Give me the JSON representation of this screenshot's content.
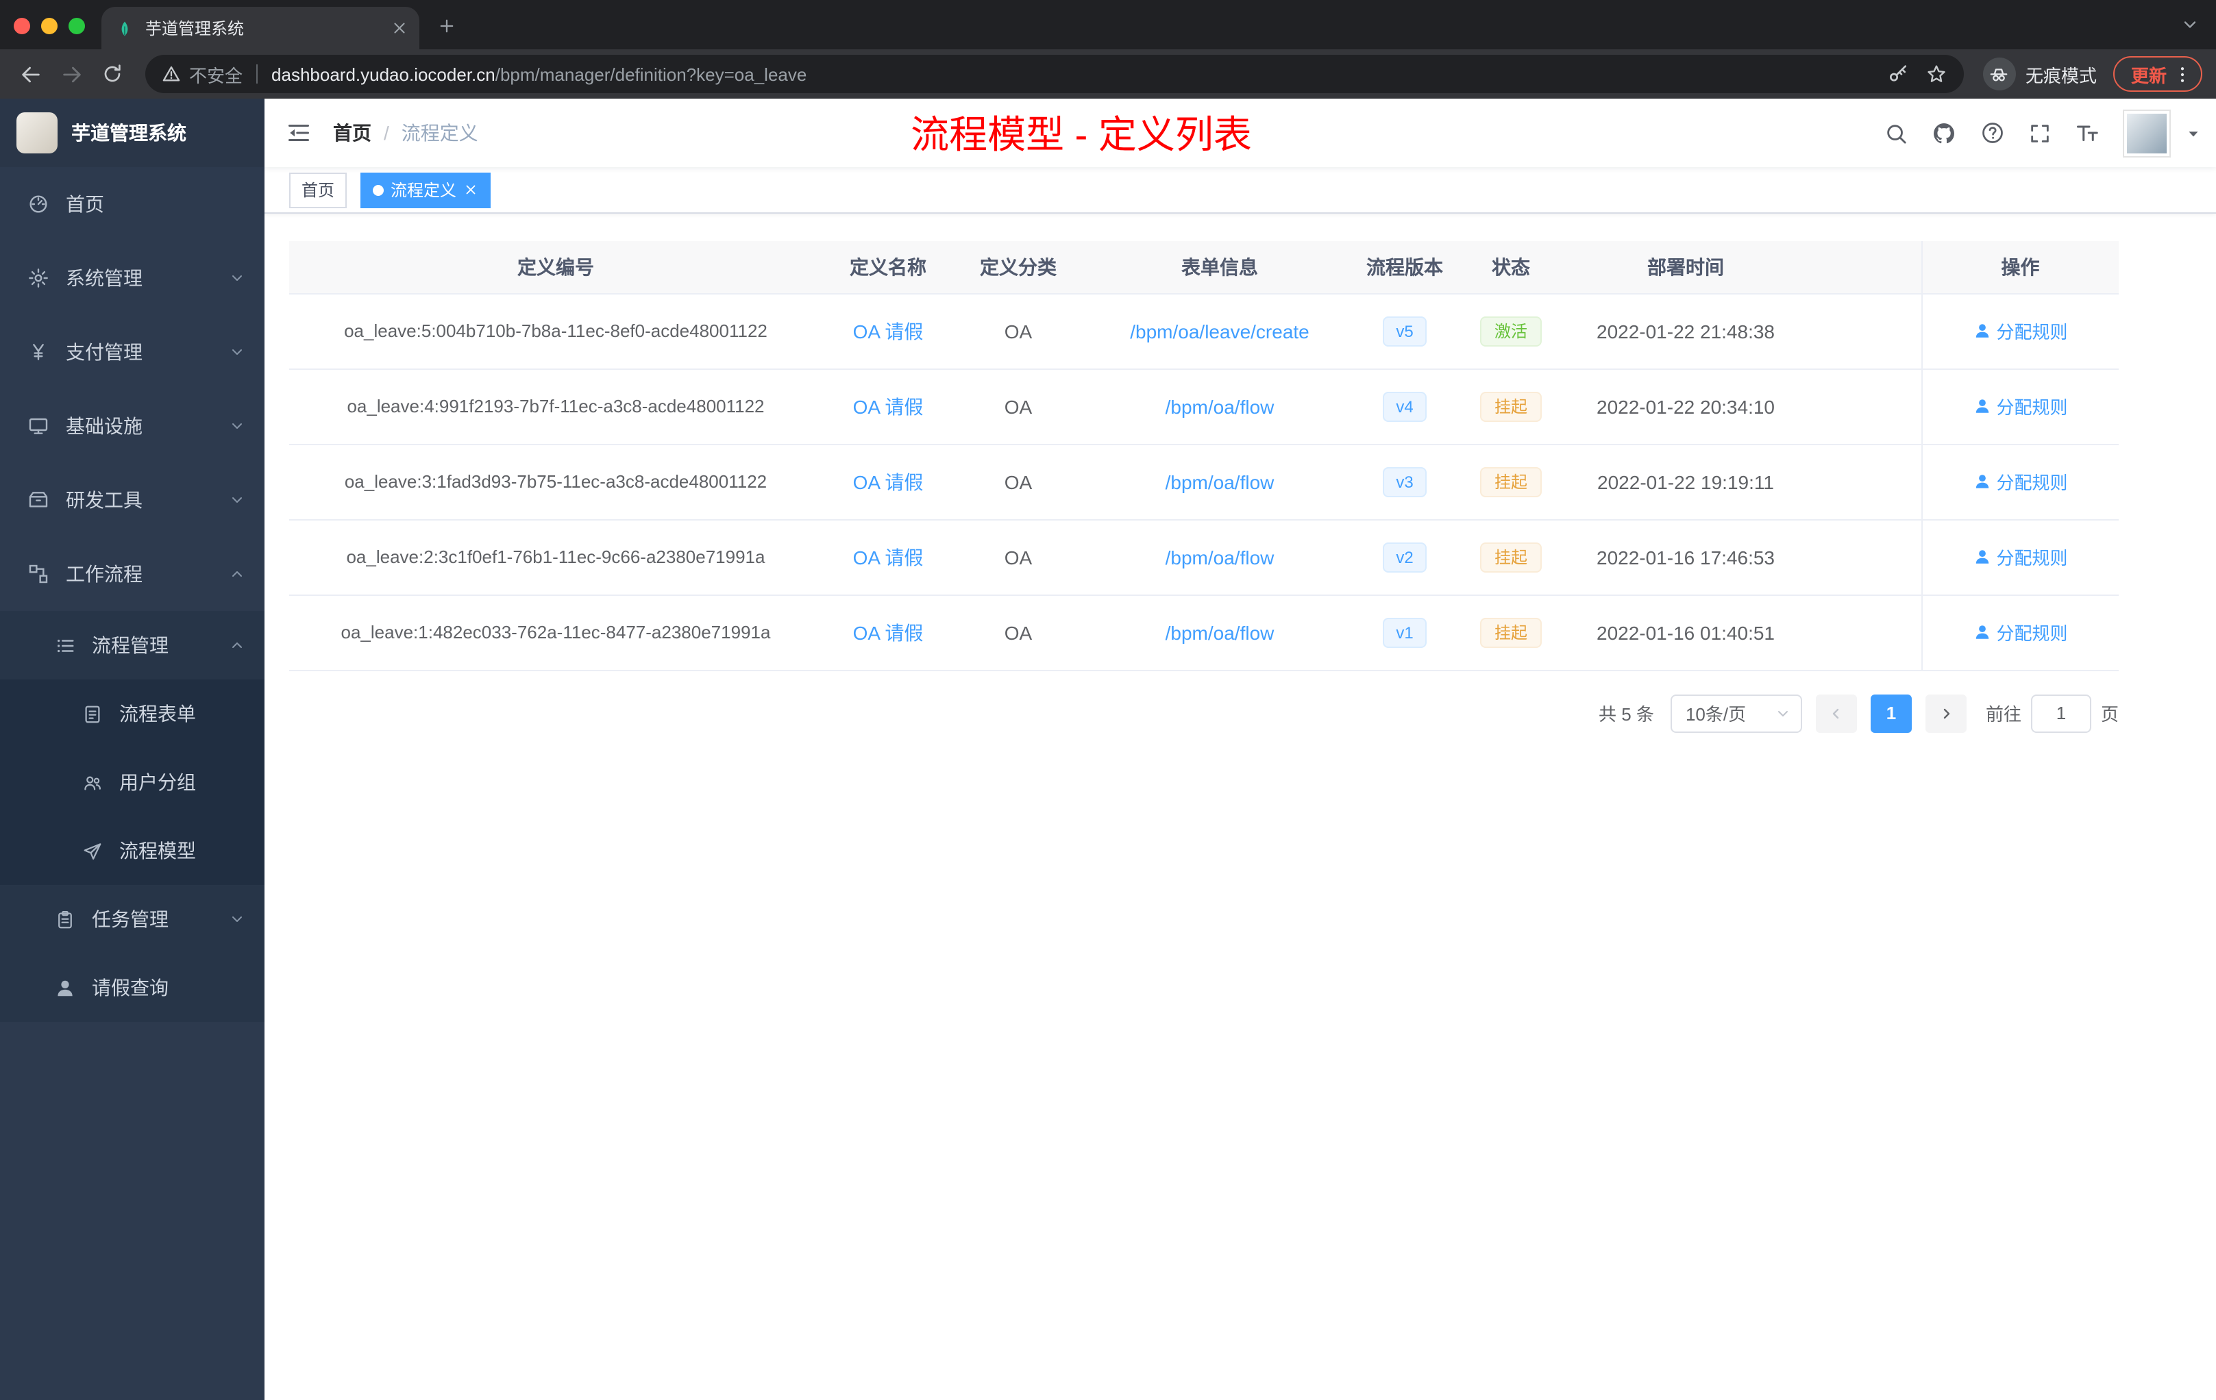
{
  "browser": {
    "tab_title": "芋道管理系统",
    "security_label": "不安全",
    "url_host": "dashboard.yudao.iocoder.cn",
    "url_path": "/bpm/manager/definition?key=oa_leave",
    "incognito_label": "无痕模式",
    "update_label": "更新"
  },
  "sidebar": {
    "logo_title": "芋道管理系统",
    "menu": [
      {
        "label": "首页"
      },
      {
        "label": "系统管理"
      },
      {
        "label": "支付管理"
      },
      {
        "label": "基础设施"
      },
      {
        "label": "研发工具"
      },
      {
        "label": "工作流程"
      }
    ],
    "workflow": {
      "process_mgmt": "流程管理",
      "process_form": "流程表单",
      "user_group": "用户分组",
      "process_model": "流程模型",
      "task_mgmt": "任务管理",
      "leave_query": "请假查询"
    }
  },
  "navbar": {
    "breadcrumb_home": "首页",
    "breadcrumb_sep": "/",
    "breadcrumb_current": "流程定义",
    "page_title": "流程模型 - 定义列表"
  },
  "tags": {
    "home": "首页",
    "current": "流程定义"
  },
  "table": {
    "headers": [
      "定义编号",
      "定义名称",
      "定义分类",
      "表单信息",
      "流程版本",
      "状态",
      "部署时间",
      "操作"
    ],
    "rows": [
      {
        "id": "oa_leave:5:004b710b-7b8a-11ec-8ef0-acde48001122",
        "name": "OA 请假",
        "category": "OA",
        "form": "/bpm/oa/leave/create",
        "version": "v5",
        "status": "激活",
        "time": "2022-01-22 21:48:38",
        "action": "分配规则"
      },
      {
        "id": "oa_leave:4:991f2193-7b7f-11ec-a3c8-acde48001122",
        "name": "OA 请假",
        "category": "OA",
        "form": "/bpm/oa/flow",
        "version": "v4",
        "status": "挂起",
        "time": "2022-01-22 20:34:10",
        "action": "分配规则"
      },
      {
        "id": "oa_leave:3:1fad3d93-7b75-11ec-a3c8-acde48001122",
        "name": "OA 请假",
        "category": "OA",
        "form": "/bpm/oa/flow",
        "version": "v3",
        "status": "挂起",
        "time": "2022-01-22 19:19:11",
        "action": "分配规则"
      },
      {
        "id": "oa_leave:2:3c1f0ef1-76b1-11ec-9c66-a2380e71991a",
        "name": "OA 请假",
        "category": "OA",
        "form": "/bpm/oa/flow",
        "version": "v2",
        "status": "挂起",
        "time": "2022-01-16 17:46:53",
        "action": "分配规则"
      },
      {
        "id": "oa_leave:1:482ec033-762a-11ec-8477-a2380e71991a",
        "name": "OA 请假",
        "category": "OA",
        "form": "/bpm/oa/flow",
        "version": "v1",
        "status": "挂起",
        "time": "2022-01-16 01:40:51",
        "action": "分配规则"
      }
    ]
  },
  "pagination": {
    "total": "共 5 条",
    "page_size": "10条/页",
    "page": "1",
    "goto_label": "前往",
    "goto_value": "1",
    "unit": "页"
  },
  "colors": {
    "accent": "#409eff",
    "title_red": "#ff0000",
    "status_active_green": "#67c23a",
    "status_suspend_yellow": "#e6a23c",
    "sidebar_bg": "#2d3a4e"
  }
}
